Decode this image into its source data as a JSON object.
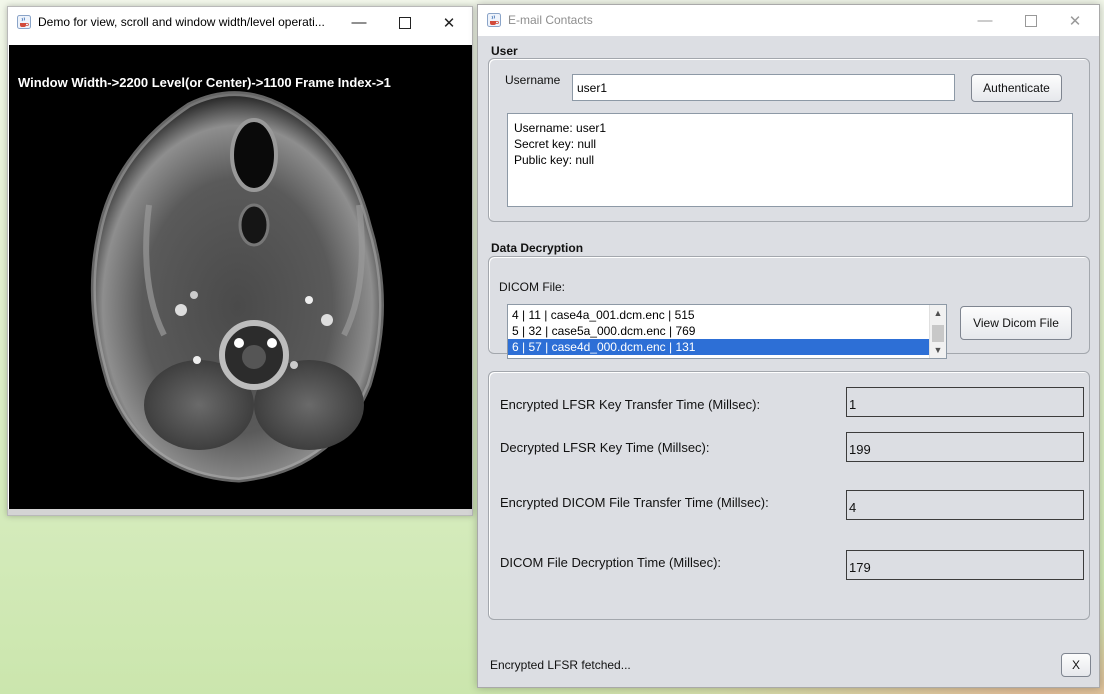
{
  "viewer_window": {
    "title": "Demo for view, scroll and window width/level operati...",
    "overlay": "Window Width->2200 Level(or Center)->1100 Frame Index->1"
  },
  "contacts_window": {
    "title": "E-mail Contacts",
    "user_section": {
      "heading": "User",
      "username_label": "Username",
      "username_value": "user1",
      "authenticate_label": "Authenticate",
      "info_lines": [
        "Username: user1",
        "Secret key: null",
        "Public key: null"
      ]
    },
    "decryption_section": {
      "heading": "Data Decryption",
      "dicom_label": "DICOM File:",
      "files": [
        "4 | 11 | case4a_001.dcm.enc | 515",
        "5 | 32 | case5a_000.dcm.enc | 769",
        "6 | 57 | case4d_000.dcm.enc | 131"
      ],
      "selected_index": 2,
      "view_button_label": "View Dicom File"
    },
    "timings": [
      {
        "label": "Encrypted LFSR Key Transfer Time (Millsec):",
        "value": "1"
      },
      {
        "label": "Decrypted LFSR Key Time (Millsec):",
        "value": "199"
      },
      {
        "label": "Encrypted DICOM File Transfer Time (Millsec):",
        "value": "4"
      },
      {
        "label": "DICOM File Decryption Time (Millsec):",
        "value": "179"
      }
    ],
    "status_text": "Encrypted LFSR fetched...",
    "close_button_label": "X"
  },
  "icons": {
    "app_icon": "java-coffee-cup-icon",
    "minimize": "minimize-icon",
    "maximize": "maximize-icon",
    "close": "close-icon"
  }
}
